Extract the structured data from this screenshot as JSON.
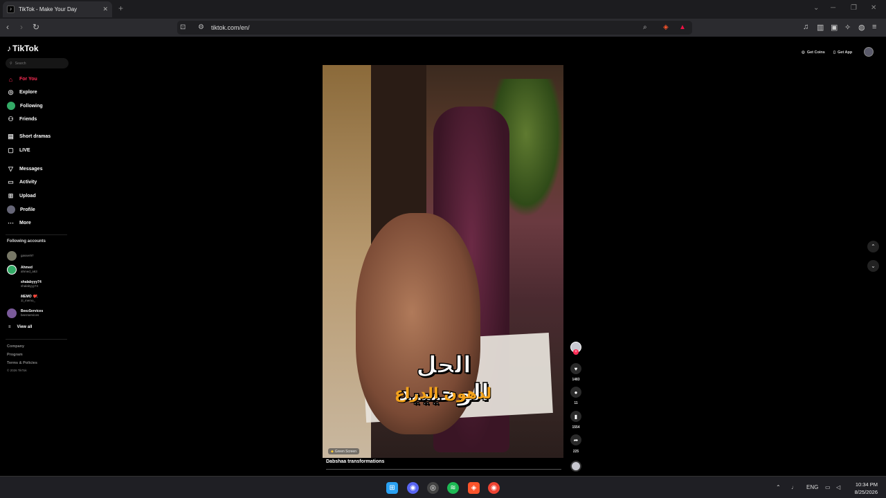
{
  "browser": {
    "tab_title": "TikTok - Make Your Day",
    "tab_close": "✕",
    "new_tab": "+",
    "url": "tiktok.com/en/"
  },
  "sidebar": {
    "logo": "TikTok",
    "search_placeholder": "Search",
    "nav": [
      {
        "label": "For You",
        "icon": "home-icon"
      },
      {
        "label": "Explore",
        "icon": "compass-icon"
      },
      {
        "label": "Following",
        "icon": "following-avatar-icon"
      },
      {
        "label": "Friends",
        "icon": "friends-icon"
      },
      {
        "label": "Short dramas",
        "icon": "dramas-icon"
      },
      {
        "label": "LIVE",
        "icon": "live-icon"
      },
      {
        "label": "Messages",
        "icon": "messages-icon"
      },
      {
        "label": "Activity",
        "icon": "activity-icon"
      },
      {
        "label": "Upload",
        "icon": "upload-icon"
      },
      {
        "label": "Profile",
        "icon": "profile-icon"
      },
      {
        "label": "More",
        "icon": "more-icon"
      }
    ],
    "following_title": "Following accounts",
    "accounts": [
      {
        "name": "",
        "handle": "gasser97"
      },
      {
        "name": "Ahmed",
        "handle": "ahmed_a63"
      },
      {
        "name": "shalabyyy74",
        "handle": "shalabyyy74"
      },
      {
        "name": "MEMO ❤️.",
        "handle": "1l_memo_"
      },
      {
        "name": "BeezServices",
        "handle": "beezservices"
      }
    ],
    "view_all": "View all",
    "footer": [
      "Company",
      "Program",
      "Terms & Policies",
      "© 2026 TikTok"
    ]
  },
  "header": {
    "get_coins": "Get Coins",
    "get_app": "Get App"
  },
  "video": {
    "caption_main": "الحل الوحيييد",
    "caption_sub": "لدهون الدراع",
    "effect_label": "Green Screen",
    "title": "Dabshaa transformations"
  },
  "actions": {
    "likes": "1483",
    "comments": "11",
    "saves": "1554",
    "shares": "225"
  },
  "taskbar": {
    "language": "ENG",
    "time": "10:34 PM",
    "date": "8/25/2026"
  },
  "colors": {
    "accent": "#fe2c55",
    "background": "#000000",
    "caption_sub": "#f3a21b"
  }
}
